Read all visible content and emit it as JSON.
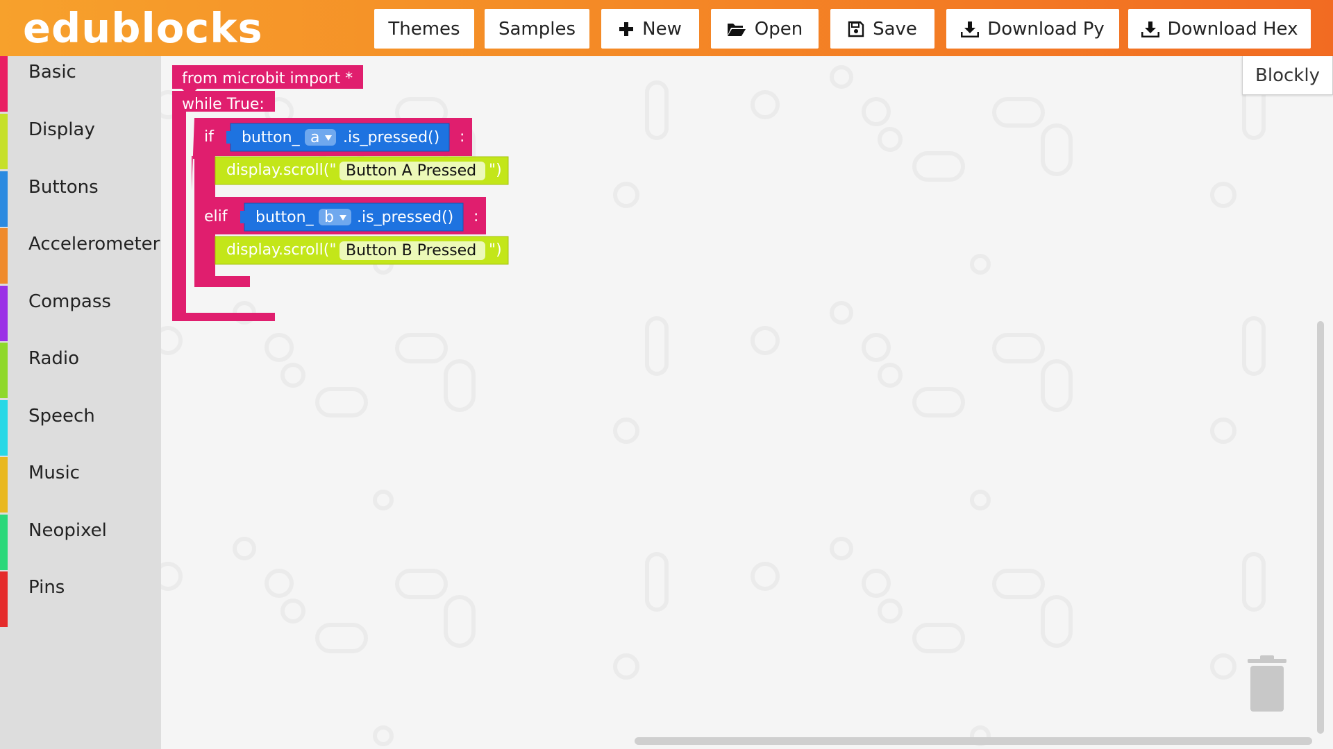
{
  "app": {
    "logo": "edublocks",
    "colors": {
      "header_start": "#f7a12c",
      "header_end": "#f26b22",
      "block_pink": "#e01e6e",
      "block_blue": "#1e73e0",
      "block_lime": "#c3e619"
    }
  },
  "toolbar": {
    "themes": "Themes",
    "samples": "Samples",
    "new": "New",
    "open": "Open",
    "save": "Save",
    "download_py": "Download Py",
    "download_hex": "Download Hex"
  },
  "sidebar": {
    "categories": [
      {
        "label": "Basic",
        "color": "#e91e63"
      },
      {
        "label": "Display",
        "color": "#c6e02a"
      },
      {
        "label": "Buttons",
        "color": "#2b8ae0"
      },
      {
        "label": "Accelerometer",
        "color": "#ef8a2b"
      },
      {
        "label": "Compass",
        "color": "#9b30e6"
      },
      {
        "label": "Radio",
        "color": "#8fd82a"
      },
      {
        "label": "Speech",
        "color": "#28d8e6"
      },
      {
        "label": "Music",
        "color": "#e9b81f"
      },
      {
        "label": "Neopixel",
        "color": "#2bd87a"
      },
      {
        "label": "Pins",
        "color": "#e52b2b"
      }
    ]
  },
  "workspace": {
    "mode_tab": "Blockly",
    "blocks": {
      "import": "from microbit import *",
      "loop": "while True:",
      "if_kw": "if",
      "elif_kw": "elif",
      "colon": ":",
      "button_prefix": "button_",
      "button_a": "a",
      "button_b": "b",
      "is_pressed": ".is_pressed()",
      "scroll_open": "display.scroll(\"",
      "scroll_close": "\")",
      "msg_a": "Button A Pressed",
      "msg_b": "Button B Pressed"
    }
  },
  "icons": [
    "plus-icon",
    "folder-open-icon",
    "floppy-disk-icon",
    "download-icon",
    "trash-icon",
    "dropdown-arrow-icon"
  ]
}
